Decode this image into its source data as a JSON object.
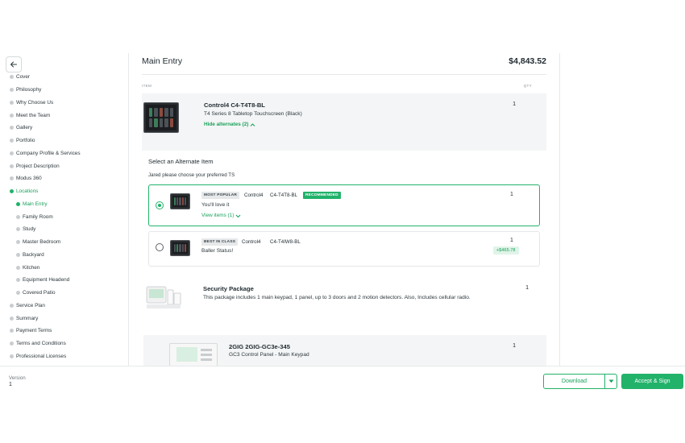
{
  "sidebar": {
    "items": [
      {
        "label": "Cover"
      },
      {
        "label": "Philosophy"
      },
      {
        "label": "Why Choose Us"
      },
      {
        "label": "Meet the Team"
      },
      {
        "label": "Gallery"
      },
      {
        "label": "Portfolio"
      },
      {
        "label": "Company Profile & Services"
      },
      {
        "label": "Project Description"
      },
      {
        "label": "Modus 360"
      },
      {
        "label": "Locations"
      },
      {
        "label": "Main Entry"
      },
      {
        "label": "Family Room"
      },
      {
        "label": "Study"
      },
      {
        "label": "Master Bedroom"
      },
      {
        "label": "Backyard"
      },
      {
        "label": "Kitchen"
      },
      {
        "label": "Equipment Headend"
      },
      {
        "label": "Covered Patio"
      },
      {
        "label": "Service Plan"
      },
      {
        "label": "Summary"
      },
      {
        "label": "Payment Terms"
      },
      {
        "label": "Terms and Conditions"
      },
      {
        "label": "Professional Licenses"
      }
    ]
  },
  "main": {
    "title": "Main Entry",
    "total": "$4,843.52",
    "columns": {
      "item": "ITEM",
      "qty": "QTY"
    },
    "primary_item": {
      "name": "Control4 C4-T4T8-BL",
      "description": "T4 Series 8 Tabletop Touchscreen (Black)",
      "qty": "1",
      "hide_alternates": "Hide alternates (2)"
    },
    "alternates": {
      "heading": "Select an Alternate Item",
      "note": "Jared please choose your preferred TS",
      "options": [
        {
          "tag": "MOST POPULAR",
          "brand": "Control4",
          "model": "C4-T4T8-BL",
          "badge": "RECOMMENDED",
          "description": "You'll love it",
          "view_items": "View items (1)",
          "qty": "1"
        },
        {
          "tag": "BEST IN CLASS",
          "brand": "Control4",
          "model": "C4-T4IW8-BL",
          "description": "Baller Status!",
          "qty": "1",
          "price_delta": "+$465.78"
        }
      ]
    },
    "security_package": {
      "name": "Security Package",
      "description": "This package includes 1 main keypad, 1 panel, up to 3 doors and 2 motion detectors. Also, Includes cellular radio.",
      "qty": "1"
    },
    "sub_item": {
      "name": "2GIG 2GIG-GC3e-345",
      "description": "GC3 Control Panel - Main Keypad",
      "qty": "1"
    }
  },
  "footer": {
    "version_label": "Version",
    "version_value": "1",
    "download_label": "Download",
    "accept_label": "Accept & Sign"
  },
  "colors": {
    "accent": "#22b26a",
    "accent_text": "#1aa15c",
    "panel_bg": "#f4f5f6"
  }
}
